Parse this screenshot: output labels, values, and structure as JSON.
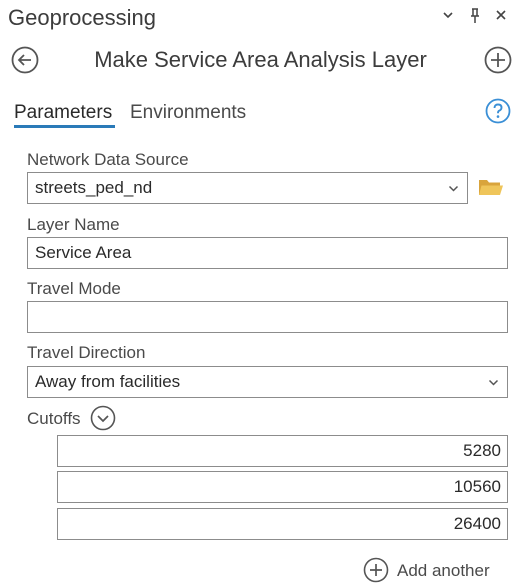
{
  "pane": {
    "title": "Geoprocessing"
  },
  "tool": {
    "title": "Make Service Area Analysis Layer"
  },
  "tabs": [
    {
      "label": "Parameters",
      "active": true
    },
    {
      "label": "Environments",
      "active": false
    }
  ],
  "params": {
    "network_data_source": {
      "label": "Network Data Source",
      "value": "streets_ped_nd"
    },
    "layer_name": {
      "label": "Layer Name",
      "value": "Service Area"
    },
    "travel_mode": {
      "label": "Travel Mode",
      "value": ""
    },
    "travel_direction": {
      "label": "Travel Direction",
      "value": "Away from facilities"
    },
    "cutoffs": {
      "label": "Cutoffs",
      "values": [
        "5280",
        "10560",
        "26400"
      ]
    }
  },
  "add_another": {
    "label": "Add another"
  },
  "colors": {
    "accent": "#2a7ab8",
    "folder": "#e8b84a",
    "help": "#3a8fd6"
  }
}
